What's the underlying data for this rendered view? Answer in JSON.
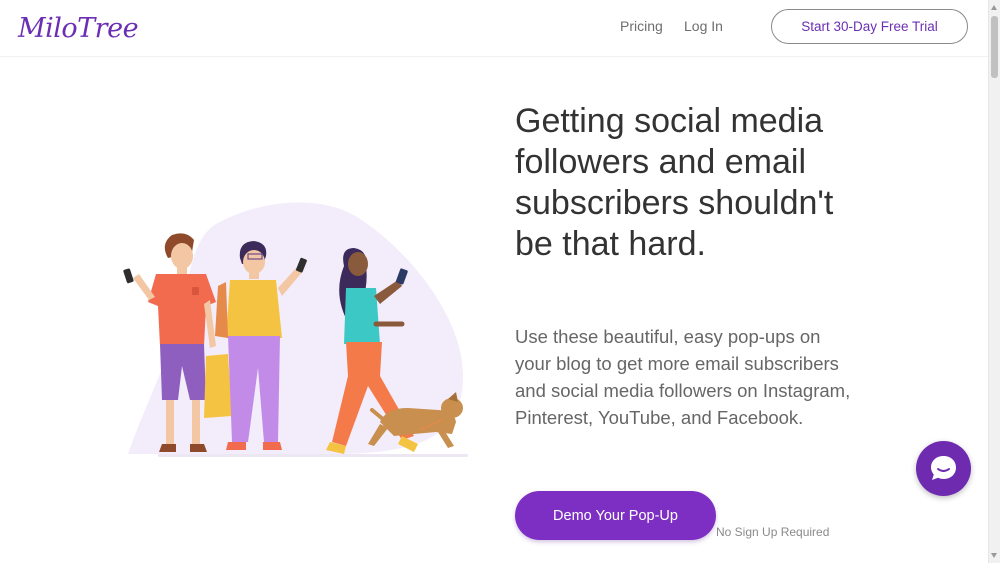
{
  "header": {
    "logo_text": "MiloTree",
    "nav": {
      "pricing": "Pricing",
      "login": "Log In"
    },
    "trial_button": "Start 30-Day Free Trial"
  },
  "hero": {
    "headline": "Getting social media followers and email subscribers shouldn't be that hard.",
    "subtext": "Use these beautiful, easy pop-ups on your blog to get more email subscribers and social media followers on Instagram, Pinterest, YouTube, and Facebook.",
    "demo_button": "Demo Your Pop-Up",
    "no_signup_note": "No Sign Up Required"
  },
  "colors": {
    "brand_purple": "#7d2fc3",
    "logo_purple": "#6b2fb3",
    "chat_purple": "#6e2bb0",
    "text_dark": "#333333",
    "text_muted": "#666666"
  },
  "icons": {
    "chat": "chat-bubble-icon",
    "logo": "milotree-logo"
  }
}
